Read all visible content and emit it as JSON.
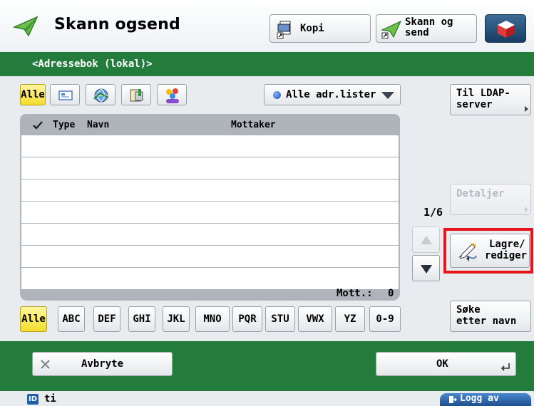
{
  "header": {
    "title": "Skann ogsend",
    "copy_label": "Kopi",
    "scan_send_label_line1": "Skann og",
    "scan_send_label_line2": "send"
  },
  "band": {
    "title": "<Adressebok (lokal)>"
  },
  "filters": {
    "all_label": "Alle",
    "addr_list_selected": "Alle adr.lister"
  },
  "list": {
    "headers": {
      "type": "Type",
      "name": "Navn",
      "recipient": "Mottaker"
    },
    "rows": [
      "",
      "",
      "",
      "",
      "",
      "",
      ""
    ],
    "count_label": "Mott.:",
    "count_value": "0"
  },
  "pagination": {
    "page": "1/6"
  },
  "side": {
    "ldap_line1": "Til LDAP-",
    "ldap_line2": "server",
    "details": "Detaljer",
    "save_line1": "Lagre/",
    "save_line2": "rediger",
    "search_line1": "Søke",
    "search_line2": "etter navn"
  },
  "alpha_tabs": [
    "Alle",
    "ABC",
    "DEF",
    "GHI",
    "JKL",
    "MNO",
    "PQR",
    "STU",
    "VWX",
    "YZ",
    "0-9"
  ],
  "footer": {
    "cancel": "Avbryte",
    "ok": "OK"
  },
  "status": {
    "user_id": "ti",
    "logout": "Logg av"
  },
  "colors": {
    "green": "#237b3c",
    "highlight_red": "#e8141c",
    "yellow": "#f4dd2c",
    "accent_blue": "#2e6bb5"
  }
}
